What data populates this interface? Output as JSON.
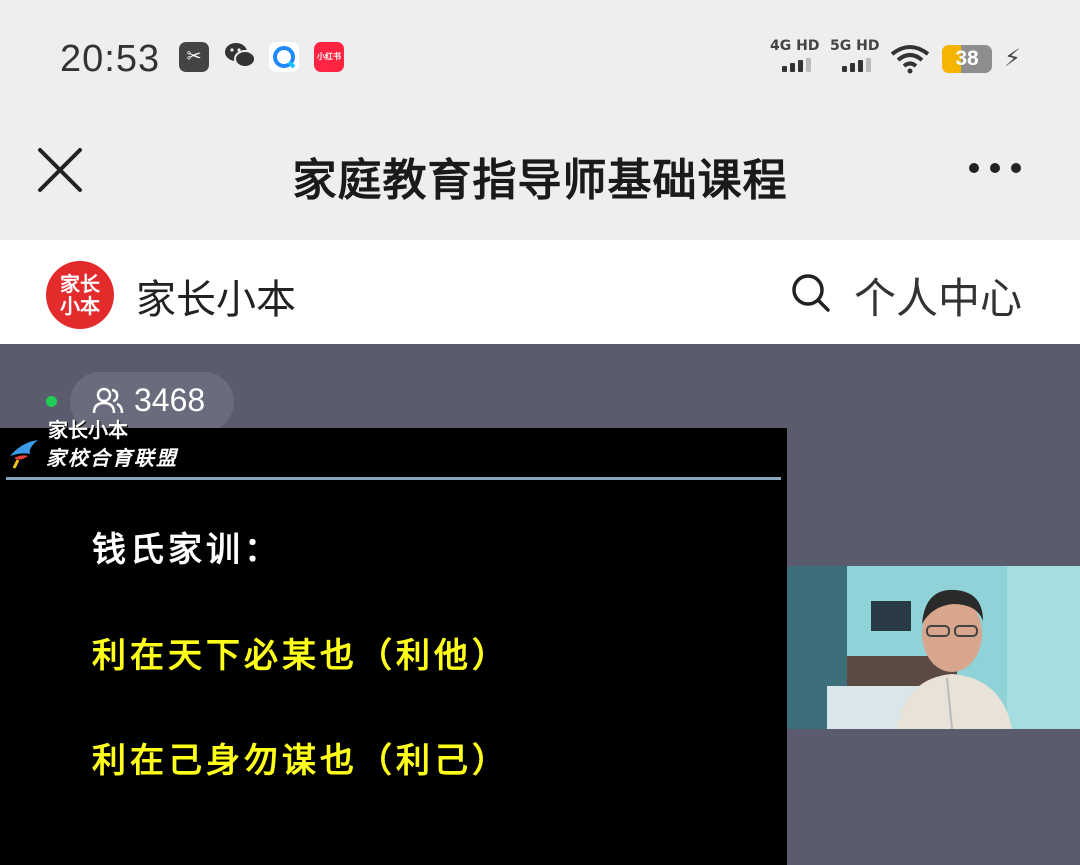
{
  "status_bar": {
    "time": "20:53",
    "app_icons": [
      "scissors-icon",
      "wechat-icon",
      "q-browser-icon",
      "xiaohongshu-icon"
    ],
    "xhs_label": "小红书",
    "signal1_label": "4G HD",
    "signal2_label": "5G HD",
    "battery": "38"
  },
  "nav": {
    "title": "家庭教育指导师基础课程"
  },
  "site_header": {
    "logo_text": "家长小本",
    "brand": "家长小本",
    "personal_center": "个人中心"
  },
  "live": {
    "viewer_count": "3468",
    "watermark": "家长小本",
    "alliance": "家校合育联盟",
    "slide_title": "钱氏家训：",
    "line1": "利在天下必某也（利他）",
    "line2": "利在己身勿谋也（利己）"
  },
  "colors": {
    "accent_red": "#e42b2b",
    "slide_yellow": "#ffff1a",
    "live_bg": "#5a5b6d",
    "battery": "#f5b400"
  }
}
